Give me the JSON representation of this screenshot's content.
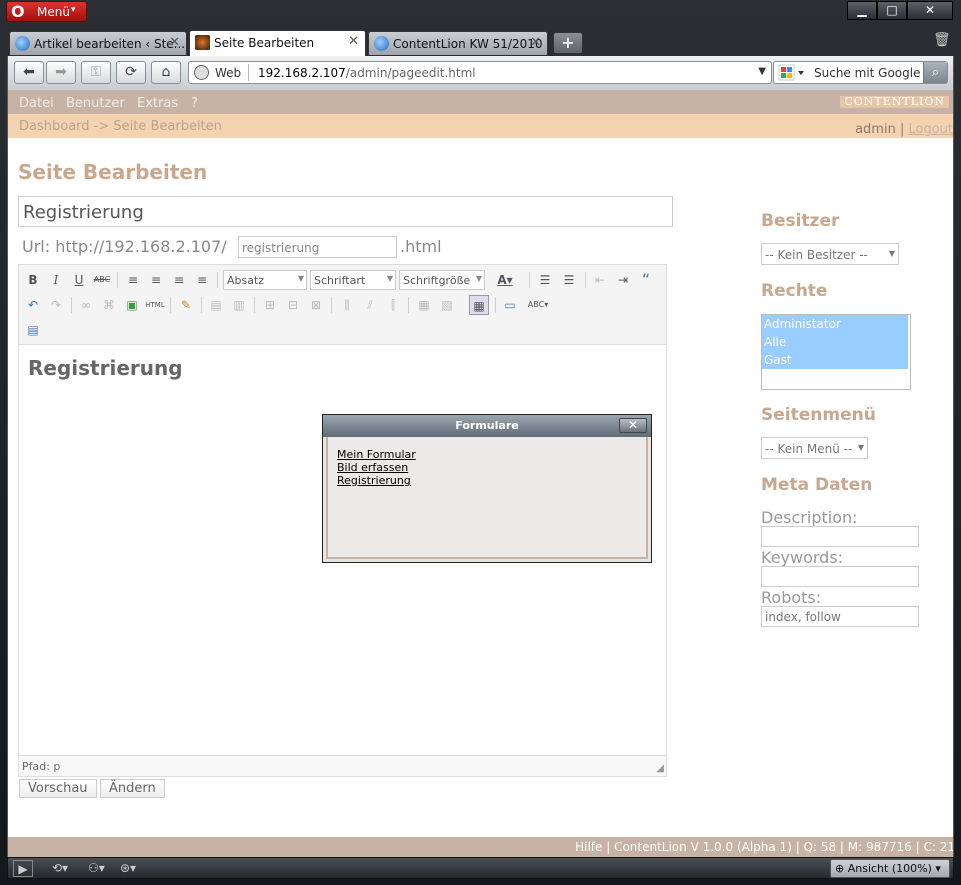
{
  "browser": {
    "menu_label": "Menü",
    "tabs": [
      {
        "label": "Artikel bearbeiten ‹ Ste..."
      },
      {
        "label": "Seite Bearbeiten"
      },
      {
        "label": "ContentLion KW 51/2010"
      }
    ],
    "address": {
      "scheme_label": "Web",
      "host": "192.168.2.107",
      "path": "/admin/pageedit.html"
    },
    "search_placeholder": "Suche mit Google",
    "zoom_label": "Ansicht (100%)"
  },
  "app": {
    "menu": [
      "Datei",
      "Benutzer",
      "Extras",
      "?"
    ],
    "logo_text": "CONTENTLION",
    "breadcrumb": "Dashboard -> Seite Bearbeiten",
    "user": "admin",
    "logout": "Logout",
    "footer": "Hilfe | ContentLion V 1.0.0 (Alpha 1) | Q: 58 | M: 987716 | C: 21"
  },
  "editor_page": {
    "title": "Seite Bearbeiten",
    "page_title_value": "Registrierung",
    "url_prefix": "Url: http://192.168.2.107/",
    "url_slug": "registrierung",
    "url_suffix": ".html",
    "toolbar": {
      "format": "Absatz",
      "font": "Schriftart",
      "size": "Schriftgröße"
    },
    "content_heading": "Registrierung",
    "status_path": "Pfad: p",
    "preview_button": "Vorschau",
    "save_button": "Ändern"
  },
  "dialog": {
    "title": "Formulare",
    "links": [
      "Mein Formular",
      "Bild erfassen",
      "Registrierung"
    ]
  },
  "sidebar": {
    "owner_heading": "Besitzer",
    "owner_value": "-- Kein Besitzer --",
    "rights_heading": "Rechte",
    "rights_options": [
      "Administator",
      "Alle",
      "Gast"
    ],
    "menu_heading": "Seitenmenü",
    "menu_value": "-- Kein Menü --",
    "meta_heading": "Meta Daten",
    "description_label": "Description:",
    "description_value": "",
    "keywords_label": "Keywords:",
    "keywords_value": "",
    "robots_label": "Robots:",
    "robots_value": "index, follow"
  }
}
